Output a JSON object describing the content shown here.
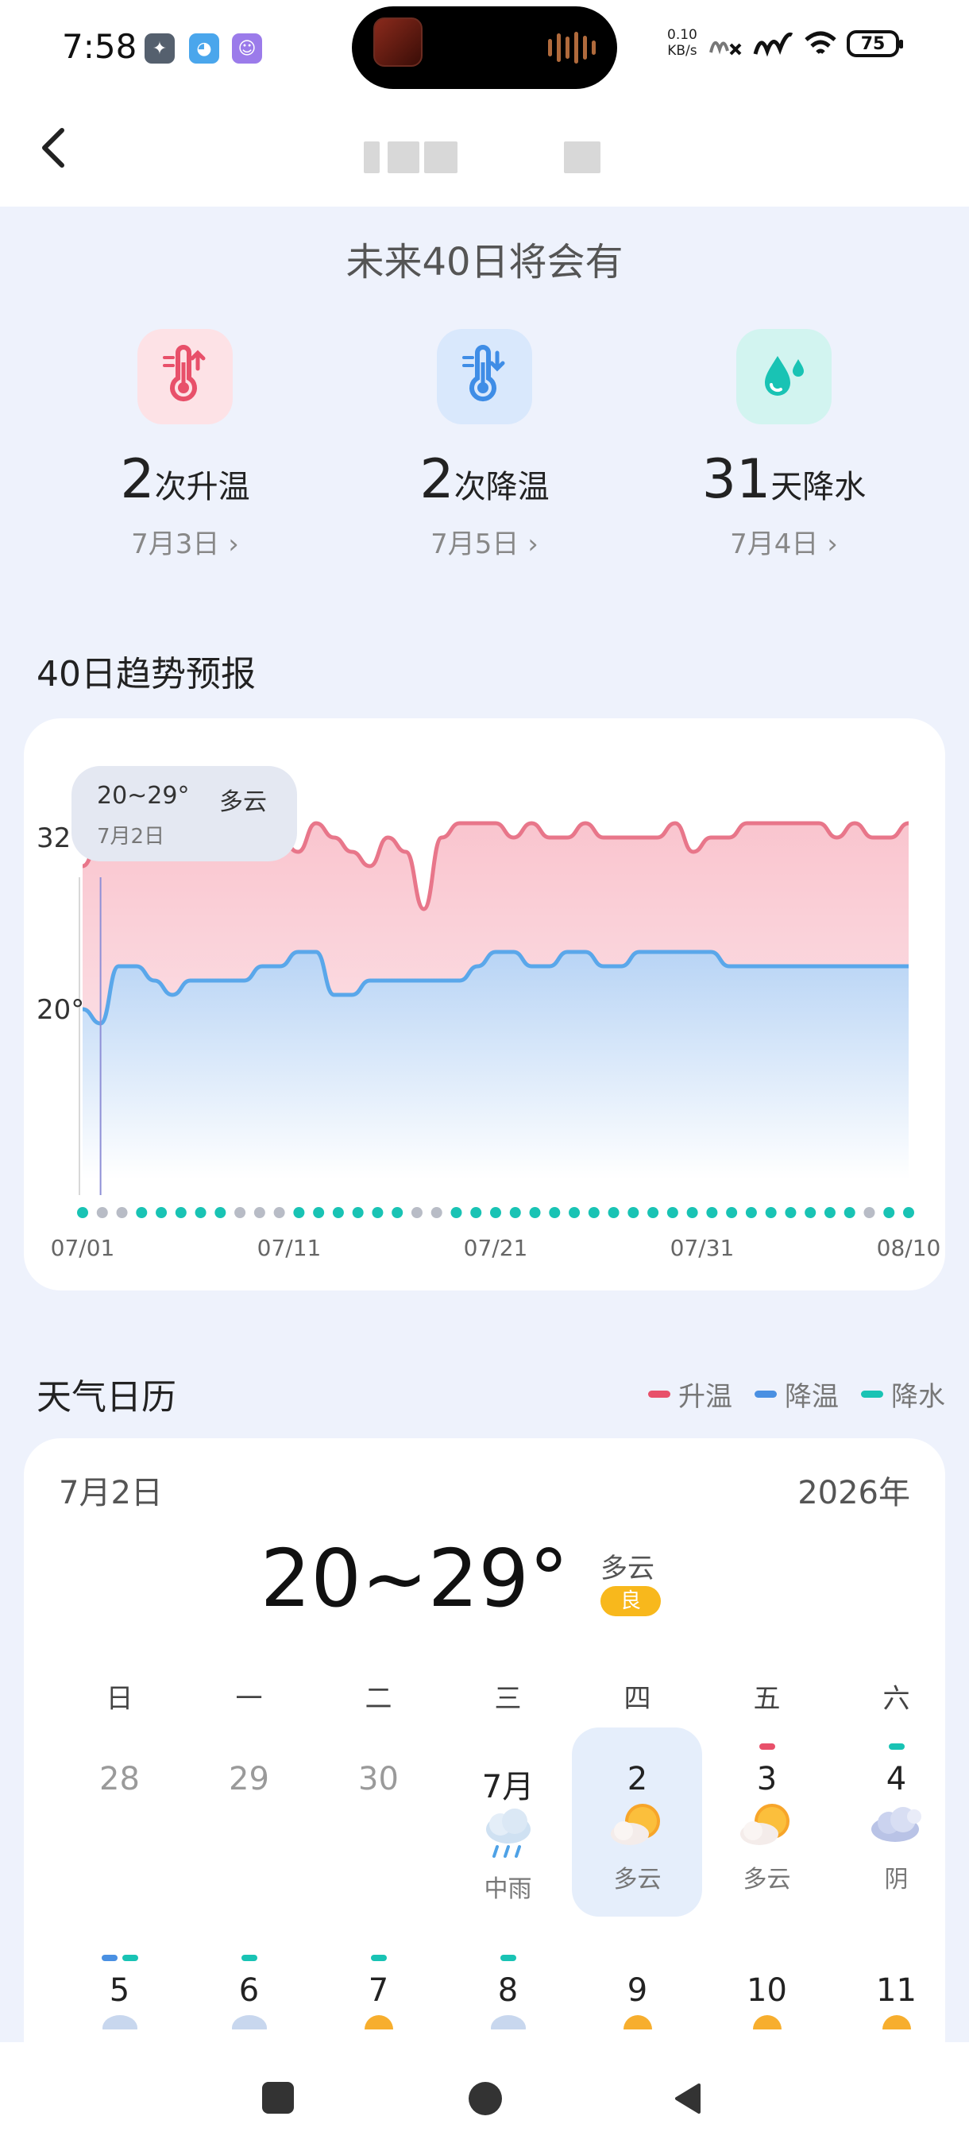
{
  "status_bar": {
    "time": "7:58",
    "net_speed_value": "0.10",
    "net_speed_unit": "KB/s",
    "battery": "75"
  },
  "header": {
    "back_icon": "chevron-left-icon"
  },
  "summary": {
    "heading": "未来40日将会有",
    "stats": [
      {
        "icon": "thermometer-up-icon",
        "count": "2",
        "unit": "次升温",
        "date": "7月3日",
        "color": "#e8506a",
        "bg": "#fde2e6"
      },
      {
        "icon": "thermometer-down-icon",
        "count": "2",
        "unit": "次降温",
        "date": "7月5日",
        "color": "#3f8de6",
        "bg": "#d9e8fc"
      },
      {
        "icon": "water-drop-icon",
        "count": "31",
        "unit": "天降水",
        "date": "7月4日",
        "color": "#19c3b4",
        "bg": "#d2f4f0"
      }
    ]
  },
  "trend": {
    "title": "40日趋势预报",
    "tooltip": {
      "range": "20~29°",
      "condition": "多云",
      "date": "7月2日"
    }
  },
  "chart_data": {
    "type": "line",
    "x_tick_labels": [
      "07/01",
      "07/11",
      "07/21",
      "07/31",
      "08/10"
    ],
    "y_tick_labels": [
      "32°",
      "20°"
    ],
    "ylim": [
      17,
      37
    ],
    "selected_index": 1,
    "series": [
      {
        "name": "最高温",
        "color": "#e8768a",
        "values": [
          30,
          32,
          34,
          34,
          34,
          32,
          32,
          32,
          33,
          32,
          31,
          32,
          31,
          33,
          32,
          31,
          30,
          32,
          31,
          27,
          32,
          33,
          33,
          33,
          32,
          33,
          32,
          32,
          33,
          32,
          32,
          32,
          32,
          33,
          31,
          32,
          32,
          33,
          33,
          33,
          33,
          33,
          32,
          33,
          32,
          32,
          33
        ]
      },
      {
        "name": "最低温",
        "color": "#5aa7ea",
        "values": [
          20,
          19,
          23,
          23,
          22,
          21,
          22,
          22,
          22,
          22,
          23,
          23,
          24,
          24,
          21,
          21,
          22,
          22,
          22,
          22,
          22,
          22,
          23,
          24,
          24,
          23,
          23,
          24,
          24,
          23,
          23,
          24,
          24,
          24,
          24,
          24,
          23,
          23,
          23,
          23,
          23,
          23,
          23,
          23,
          23,
          23,
          23
        ]
      }
    ],
    "precip_dots": [
      "r",
      "g",
      "g",
      "r",
      "r",
      "r",
      "r",
      "r",
      "g",
      "g",
      "g",
      "r",
      "r",
      "r",
      "r",
      "r",
      "r",
      "g",
      "g",
      "r",
      "r",
      "r",
      "r",
      "r",
      "r",
      "r",
      "r",
      "r",
      "r",
      "r",
      "r",
      "r",
      "r",
      "r",
      "r",
      "r",
      "r",
      "r",
      "r",
      "r",
      "g",
      "r",
      "r"
    ]
  },
  "calendar": {
    "title": "天气日历",
    "legend": [
      {
        "label": "升温",
        "color": "#e8506a"
      },
      {
        "label": "降温",
        "color": "#4a90e2"
      },
      {
        "label": "降水",
        "color": "#19c3b4"
      }
    ],
    "selected_date": "7月2日",
    "year": "2026年",
    "temp_range": "20~29°",
    "condition": "多云",
    "aqi": "良",
    "weekdays": [
      "日",
      "一",
      "二",
      "三",
      "四",
      "五",
      "六"
    ],
    "row1": [
      {
        "num": "28",
        "dim": true,
        "label": "",
        "icon": ""
      },
      {
        "num": "29",
        "dim": true,
        "label": "",
        "icon": ""
      },
      {
        "num": "30",
        "dim": true,
        "label": "",
        "icon": ""
      },
      {
        "num": "7月",
        "dim": false,
        "label": "中雨",
        "icon": "rain-cloud-icon"
      },
      {
        "num": "2",
        "dim": false,
        "label": "多云",
        "icon": "partly-cloudy-icon"
      },
      {
        "num": "3",
        "dim": false,
        "label": "多云",
        "icon": "partly-cloudy-icon"
      },
      {
        "num": "4",
        "dim": false,
        "label": "阴",
        "icon": "cloud-icon"
      }
    ],
    "row2": [
      {
        "num": "5",
        "icon": "cloud-icon"
      },
      {
        "num": "6",
        "icon": "cloud-icon"
      },
      {
        "num": "7",
        "icon": "sun-icon"
      },
      {
        "num": "8",
        "icon": "cloud-icon"
      },
      {
        "num": "9",
        "icon": "sun-icon"
      },
      {
        "num": "10",
        "icon": "sun-icon"
      },
      {
        "num": "11",
        "icon": "sun-icon"
      }
    ]
  }
}
